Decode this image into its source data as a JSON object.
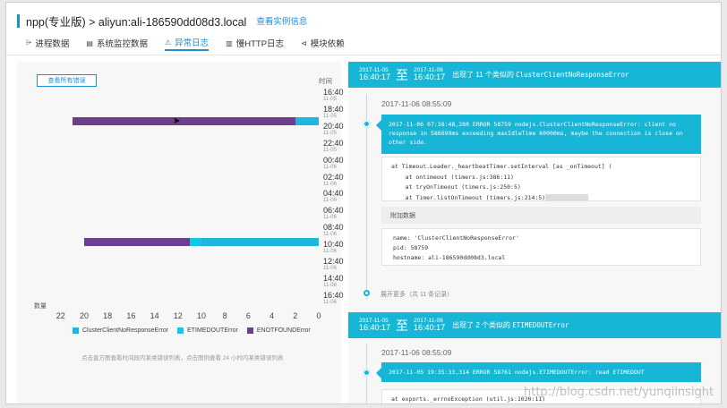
{
  "header": {
    "title": "npp(专业版) > aliyun:ali-186590dd08d3.local",
    "instance_link": "查看实例信息"
  },
  "tabs": [
    {
      "label": "进程数据",
      "icon": "process-icon"
    },
    {
      "label": "系统监控数据",
      "icon": "monitor-icon"
    },
    {
      "label": "异常日志",
      "icon": "warning-icon",
      "active": true
    },
    {
      "label": "慢HTTP日志",
      "icon": "trash-icon"
    },
    {
      "label": "模块依赖",
      "icon": "module-icon"
    }
  ],
  "chart": {
    "all_errors_button": "查看所有错误",
    "time_label": "时间",
    "count_label": "数量",
    "hint": "点击直方图查看时间段内某类错误列表，点击图例查看 24 小时内某类错误列表",
    "y_ticks": [
      {
        "time": "16:40",
        "date": "11-05"
      },
      {
        "time": "18:40",
        "date": "11-05"
      },
      {
        "time": "20:40",
        "date": "11-05"
      },
      {
        "time": "22:40",
        "date": "11-05"
      },
      {
        "time": "00:40",
        "date": "11-06"
      },
      {
        "time": "02:40",
        "date": "11-06"
      },
      {
        "time": "04:40",
        "date": "11-06"
      },
      {
        "time": "06:40",
        "date": "11-06"
      },
      {
        "time": "08:40",
        "date": "11-06"
      },
      {
        "time": "10:40",
        "date": "11-06"
      },
      {
        "time": "12:40",
        "date": "11-06"
      },
      {
        "time": "14:40",
        "date": "11-06"
      },
      {
        "time": "16:40",
        "date": "11-06"
      }
    ],
    "x_ticks": [
      "22",
      "20",
      "18",
      "16",
      "14",
      "12",
      "10",
      "8",
      "6",
      "4",
      "2",
      "0"
    ],
    "legend": [
      {
        "name": "ClusterClientNoResponseError",
        "color": "#1fb6d9"
      },
      {
        "name": "ETIMEDOUTError",
        "color": "#12c6e6"
      },
      {
        "name": "ENOTFOUNDError",
        "color": "#6b3f8c"
      }
    ]
  },
  "chart_data": {
    "type": "bar",
    "orientation": "horizontal-stacked",
    "x_axis": "数量",
    "x_range": [
      24,
      0
    ],
    "y_axis": "时间",
    "series": [
      {
        "name": "ClusterClientNoResponseError",
        "color": "#1fb6d9",
        "values": [
          {
            "time": "19:40 11-05",
            "value": 2
          },
          {
            "time": "09:40 11-06",
            "value": 10
          }
        ]
      },
      {
        "name": "ETIMEDOUTError",
        "color": "#12c6e6",
        "values": [
          {
            "time": "09:40 11-06",
            "value": 1
          }
        ]
      },
      {
        "name": "ENOTFOUNDError",
        "color": "#6b3f8c",
        "values": [
          {
            "time": "19:40 11-05",
            "value": 19
          },
          {
            "time": "09:40 11-06",
            "value": 9
          }
        ]
      }
    ]
  },
  "groups": [
    {
      "start_date": "2017-11-05",
      "start_time": "16:40:17",
      "zhi": "至",
      "end_date": "2017-11-06",
      "end_time": "16:40:17",
      "title_prefix": "出现了 11 个类似的",
      "error_name": "ClusterClientNoResponseError",
      "occurrence_time": "2017-11-06 08:55:09",
      "message": "2017-11-06 07:38:48,280 ERROR 58759 nodejs.ClusterClientNoResponseError: client no response in 586699ms exceeding maxIdleTime 60000ms, maybe the connection is close on other side.",
      "stack": "at Timeout.Leader._heartbeatTimer.setInterval [as _onTimeout] (\n    at ontimeout (timers.js:386:11)\n    at tryOnTimeout (timers.js:250:5)\n    at Timer.listOnTimeout (timers.js:214:5)",
      "extra_label": "附加数据",
      "extra": "name: 'ClusterClientNoResponseError'\npid: 58759\nhostname: ali-186590dd08d3.local",
      "expand": "展开更多（共 11 条记录）"
    },
    {
      "start_date": "2017-11-05",
      "start_time": "16:40:17",
      "zhi": "至",
      "end_date": "2017-11-06",
      "end_time": "16:40:17",
      "title_prefix": "出现了 2 个类似的",
      "error_name": "ETIMEDOUTError",
      "occurrence_time": "2017-11-06 08:55:09",
      "message": "2017-11-05 19:35:33,314 ERROR 58761 nodejs.ETIMEDOUTError: read ETIMEDOUT",
      "stack": "at exports._errnoException (util.js:1020:11)"
    }
  ],
  "watermark": "http://blog.csdn.net/yunqiinsight"
}
